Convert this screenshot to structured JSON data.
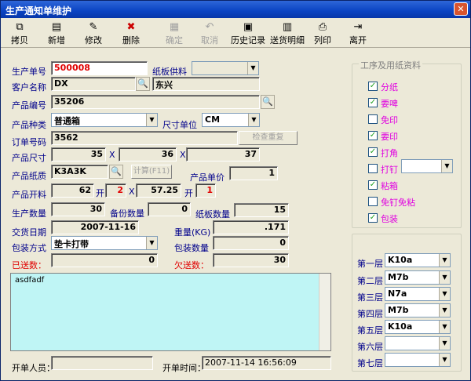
{
  "window": {
    "title": "生产通知单维护",
    "close": "✕"
  },
  "toolbar": [
    {
      "label": "拷贝",
      "icon": "copy-icon",
      "glyph": "⧉",
      "enabled": true
    },
    {
      "label": "新增",
      "icon": "new-icon",
      "glyph": "▤",
      "enabled": true
    },
    {
      "label": "修改",
      "icon": "edit-icon",
      "glyph": "✎",
      "enabled": true
    },
    {
      "label": "删除",
      "icon": "delete-icon",
      "glyph": "✖",
      "enabled": true
    },
    {
      "label": "确定",
      "icon": "confirm-icon",
      "glyph": "▦",
      "enabled": false
    },
    {
      "label": "取消",
      "icon": "undo-icon",
      "glyph": "↶",
      "enabled": false
    },
    {
      "label": "历史记录",
      "icon": "history-icon",
      "glyph": "▣",
      "enabled": true
    },
    {
      "label": "送货明细",
      "icon": "delivery-icon",
      "glyph": "▥",
      "enabled": true
    },
    {
      "label": "列印",
      "icon": "print-icon",
      "glyph": "⎙",
      "enabled": true
    },
    {
      "label": "离开",
      "icon": "exit-icon",
      "glyph": "⇥",
      "enabled": true
    }
  ],
  "form": {
    "order_no_label": "生产单号",
    "order_no": "500008",
    "board_supply_label": "纸板供料",
    "board_supply": "",
    "customer_label": "客户名称",
    "customer_code": "DX",
    "customer_name": "东兴",
    "product_code_label": "产品编号",
    "product_code": "35206",
    "product_type_label": "产品种类",
    "product_type": "普通箱",
    "size_unit_label": "尺寸单位",
    "size_unit": "CM",
    "order_code_label": "订单号码",
    "order_code": "3562",
    "check_dup_btn": "检查重复",
    "product_size_label": "产品尺寸",
    "size_l": "35",
    "size_w": "36",
    "size_h": "37",
    "x": "X",
    "paper_label": "产品纸质",
    "paper": "K3A3K",
    "calc_btn": "计算(F11)",
    "unit_price_label": "产品单价",
    "unit_price": "1",
    "cut_label": "产品开料",
    "cut_a": "62",
    "kai1": "开",
    "cut_b": "2",
    "cut_c": "57.25",
    "kai2": "开",
    "cut_d": "1",
    "qty_label": "生产数量",
    "qty": "30",
    "spare_label": "备份数量",
    "spare": "0",
    "board_qty_label": "纸板数量",
    "board_qty": "15",
    "date_label": "交货日期",
    "date": "2007-11-16",
    "weight_label": "重量(KG)",
    "weight": ".171",
    "pack_method_label": "包装方式",
    "pack_method": "垫卡打带",
    "pack_qty_label": "包装数量",
    "pack_qty": "0",
    "sent_label": "已送数：",
    "sent": "0",
    "owed_label": "欠送数：",
    "owed": "30",
    "memo": "asdfadf",
    "creator_label": "开单人员：",
    "creator": "",
    "created_label": "开单时间：",
    "created": "2007-11-14 16:56:09"
  },
  "process": {
    "title": "工序及用纸资料",
    "items": [
      {
        "label": "分纸",
        "checked": true
      },
      {
        "label": "要啤",
        "checked": true
      },
      {
        "label": "免印",
        "checked": false
      },
      {
        "label": "要印",
        "checked": true
      },
      {
        "label": "打角",
        "checked": true
      },
      {
        "label": "打钉",
        "checked": false
      },
      {
        "label": "粘箱",
        "checked": true
      },
      {
        "label": "免钉免粘",
        "checked": false
      },
      {
        "label": "包装",
        "checked": true
      }
    ],
    "nail_value": ""
  },
  "layers": [
    {
      "label": "第一层",
      "value": "K10a"
    },
    {
      "label": "第二层",
      "value": "M7b"
    },
    {
      "label": "第三层",
      "value": "N7a"
    },
    {
      "label": "第四层",
      "value": "M7b"
    },
    {
      "label": "第五层",
      "value": "K10a"
    },
    {
      "label": "第六层",
      "value": ""
    },
    {
      "label": "第七层",
      "value": ""
    }
  ],
  "check_mark": "✓",
  "arrow": "▼",
  "mag": "🔍"
}
